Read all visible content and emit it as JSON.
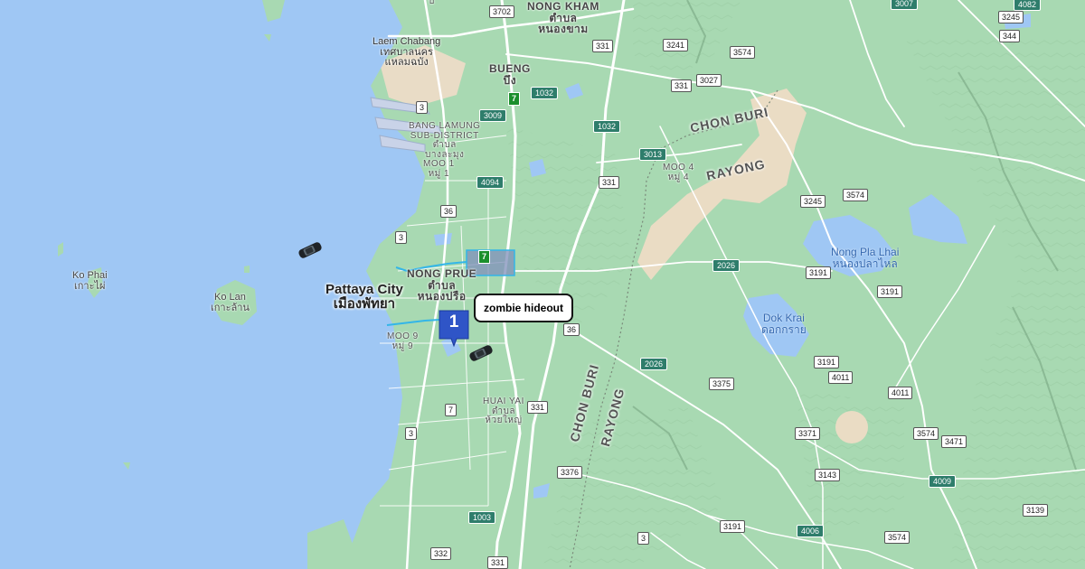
{
  "map": {
    "places": {
      "pattaya": {
        "en": "Pattaya City",
        "th": "เมืองพัทยา"
      },
      "laem_chabang": {
        "en": "Laem Chabang",
        "th1": "เทศบาลนคร",
        "th2": "แหลมฉบัง"
      },
      "nong_prue": {
        "en": "NONG PRUE",
        "th1": "ตำบล",
        "th2": "หนองปรือ"
      },
      "bang_lamung": {
        "en1": "BANG LAMUNG",
        "en2": "SUB-DISTRICT",
        "th1": "ตำบล",
        "th2": "บางละมุง"
      },
      "moo1": {
        "en": "MOO 1",
        "th": "หมู่ 1"
      },
      "moo9": {
        "en": "MOO 9",
        "th": "หมู่ 9"
      },
      "moo4": {
        "en": "MOO 4",
        "th": "หมู่ 4"
      },
      "bueng": {
        "en": "BUENG",
        "th": "บึง"
      },
      "nong_kham": {
        "en": "NONG KHAM",
        "th1": "ตำบล",
        "th2": "หนองขาม"
      },
      "huai_yai": {
        "en": "HUAI YAI",
        "th1": "ตำบล",
        "th2": "ห้วยใหญ่"
      },
      "top_island": {
        "th": "บ"
      }
    },
    "islands": {
      "ko_phai": {
        "en": "Ko Phai",
        "th": "เกาะไผ่"
      },
      "ko_lan": {
        "en": "Ko Lan",
        "th": "เกาะล้าน"
      }
    },
    "water": {
      "nong_pla_lhai": {
        "en": "Nong Pla Lhai",
        "th": "หนองปลาไหล"
      },
      "dok_krai": {
        "en": "Dok Krai",
        "th": "ดอกกราย"
      }
    },
    "admin": {
      "chon_buri_top": "CHON BURI",
      "rayong_top": "RAYONG",
      "chon_buri_vertical": "CHON BURI",
      "rayong_vertical": "RAYONG"
    },
    "routes": {
      "r3702": "3702",
      "r331a": "331",
      "r3241": "3241",
      "r3574a": "3574",
      "r3007": "3007",
      "r3245a": "3245",
      "r4082": "4082",
      "r344": "344",
      "r3027": "3027",
      "r331b": "331",
      "r1032a": "1032",
      "r3009": "3009",
      "r1032b": "1032",
      "r3013": "3013",
      "r331c": "331",
      "r4094": "4094",
      "r3245b": "3245",
      "r3574b": "3574",
      "r3a": "3",
      "r36a": "36",
      "r3b": "3",
      "r2026a": "2026",
      "r3191a": "3191",
      "r3191b": "3191",
      "r36b": "36",
      "r2026b": "2026",
      "r3191c": "3191",
      "r4011a": "4011",
      "r3375": "3375",
      "r4011b": "4011",
      "r7a": "7",
      "r331d": "331",
      "r3b2": "3",
      "r3371": "3371",
      "r3574c": "3574",
      "r3471": "3471",
      "r3376": "3376",
      "r3143": "3143",
      "r4009": "4009",
      "r1003": "1003",
      "r3191d": "3191",
      "r4006": "4006",
      "r3139": "3139",
      "r332": "332",
      "r3c": "3",
      "r3574d": "3574",
      "r331e": "331",
      "hw7a": "7",
      "hw7b": "7"
    },
    "marker": {
      "number": "1",
      "tooltip": "zombie hideout",
      "color": "#2f55c7"
    }
  }
}
